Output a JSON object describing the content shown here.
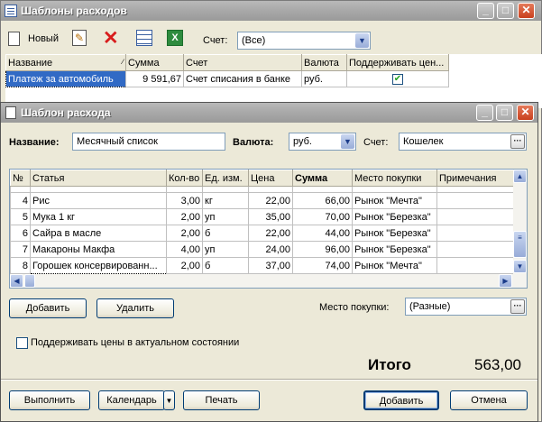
{
  "main": {
    "title": "Шаблоны расходов",
    "toolbar": {
      "new_label": "Новый",
      "account_label": "Счет:",
      "account_value": "(Все)"
    },
    "columns": [
      "Название",
      "Сумма",
      "Счет",
      "Валюта",
      "Поддерживать цен..."
    ],
    "rows": [
      {
        "name": "Платеж за автомобиль",
        "sum": "9 591,67",
        "account": "Счет списания в банке",
        "currency": "руб.",
        "keep": true
      }
    ]
  },
  "dialog": {
    "title": "Шаблон расхода",
    "name_label": "Название:",
    "name_value": "Месячный список",
    "currency_label": "Валюта:",
    "currency_value": "руб.",
    "account_label": "Счет:",
    "account_value": "Кошелек",
    "columns": [
      "№",
      "Статья",
      "Кол-во",
      "Ед. изм.",
      "Цена",
      "Сумма",
      "Место покупки",
      "Примечания"
    ],
    "rows": [
      {
        "n": "4",
        "item": "Рис",
        "qty": "3,00",
        "unit": "кг",
        "price": "22,00",
        "sum": "66,00",
        "place": "Рынок \"Мечта\"",
        "note": ""
      },
      {
        "n": "5",
        "item": "Мука 1 кг",
        "qty": "2,00",
        "unit": "уп",
        "price": "35,00",
        "sum": "70,00",
        "place": "Рынок \"Березка\"",
        "note": ""
      },
      {
        "n": "6",
        "item": "Сайра в масле",
        "qty": "2,00",
        "unit": "б",
        "price": "22,00",
        "sum": "44,00",
        "place": "Рынок \"Березка\"",
        "note": ""
      },
      {
        "n": "7",
        "item": "Макароны Макфа",
        "qty": "4,00",
        "unit": "уп",
        "price": "24,00",
        "sum": "96,00",
        "place": "Рынок \"Березка\"",
        "note": ""
      },
      {
        "n": "8",
        "item": "Горошек консервированн...",
        "qty": "2,00",
        "unit": "б",
        "price": "37,00",
        "sum": "74,00",
        "place": "Рынок \"Мечта\"",
        "note": ""
      }
    ],
    "add_label": "Добавить",
    "delete_label": "Удалить",
    "place_label": "Место покупки:",
    "place_value": "(Разные)",
    "keep_prices_label": "Поддерживать цены в актуальном состоянии",
    "total_label": "Итого",
    "total_value": "563,00",
    "footer": {
      "run": "Выполнить",
      "calendar": "Календарь",
      "print": "Печать",
      "add": "Добавить",
      "cancel": "Отмена"
    }
  }
}
